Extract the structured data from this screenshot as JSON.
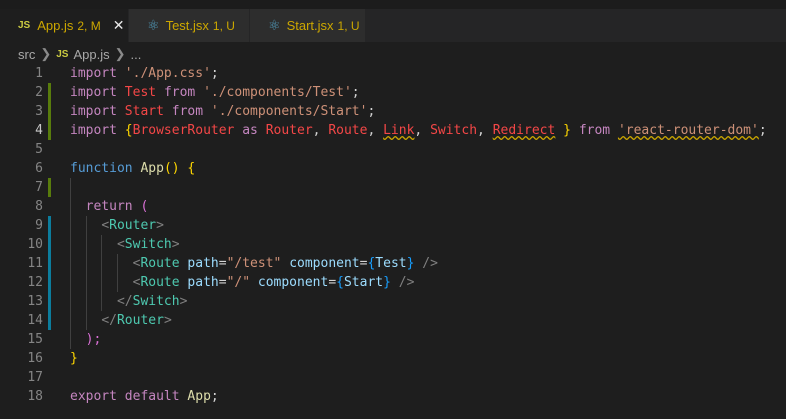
{
  "tabs": [
    {
      "icon": "JS",
      "name": "App.js",
      "status": "2, M",
      "active": true
    },
    {
      "icon": "react",
      "name": "Test.jsx",
      "status": "1, U",
      "active": false
    },
    {
      "icon": "react",
      "name": "Start.jsx",
      "status": "1, U",
      "active": false
    }
  ],
  "breadcrumb": {
    "folder": "src",
    "file_icon": "JS",
    "file": "App.js",
    "symbol": "..."
  },
  "line_numbers": [
    "1",
    "2",
    "3",
    "4",
    "5",
    "6",
    "7",
    "8",
    "9",
    "10",
    "11",
    "12",
    "13",
    "14",
    "15",
    "16",
    "17",
    "18"
  ],
  "code": {
    "l1": {
      "kw": "import",
      "str": "'./App.css'",
      "end": ";"
    },
    "l2": {
      "kw": "import",
      "id": "Test",
      "from": "from",
      "str": "'./components/Test'",
      "end": ";"
    },
    "l3": {
      "kw": "import",
      "id": "Start",
      "from": "from",
      "str": "'./components/Start'",
      "end": ";"
    },
    "l4": {
      "kw": "import",
      "open": "{",
      "a": "BrowserRouter",
      "as": "as",
      "b": "Router",
      "c": "Route",
      "d": "Link",
      "e": "Switch",
      "f": "Redirect",
      "close": "}",
      "from": "from",
      "str": "'react-router-dom'",
      "end": ";"
    },
    "l6": {
      "kw": "function",
      "name": "App",
      "rest": "() {"
    },
    "l8": {
      "kw": "return",
      "rest": "("
    },
    "l9": {
      "tag": "Router"
    },
    "l10": {
      "tag": "Switch"
    },
    "l11": {
      "tag": "Route",
      "attr1": "path",
      "val1": "\"/test\"",
      "attr2": "component",
      "ref": "Test"
    },
    "l12": {
      "tag": "Route",
      "attr1": "path",
      "val1": "\"/\"",
      "attr2": "component",
      "ref": "Start"
    },
    "l13": {
      "tag": "Switch"
    },
    "l14": {
      "tag": "Router"
    },
    "l15": {
      "text": ");"
    },
    "l16": {
      "text": "}"
    },
    "l18": {
      "kw": "export",
      "kw2": "default",
      "id": "App",
      "end": ";"
    }
  },
  "colors": {
    "added": "#587c0c",
    "modified": "#0c7d9d",
    "background": "#1e1e1e"
  }
}
